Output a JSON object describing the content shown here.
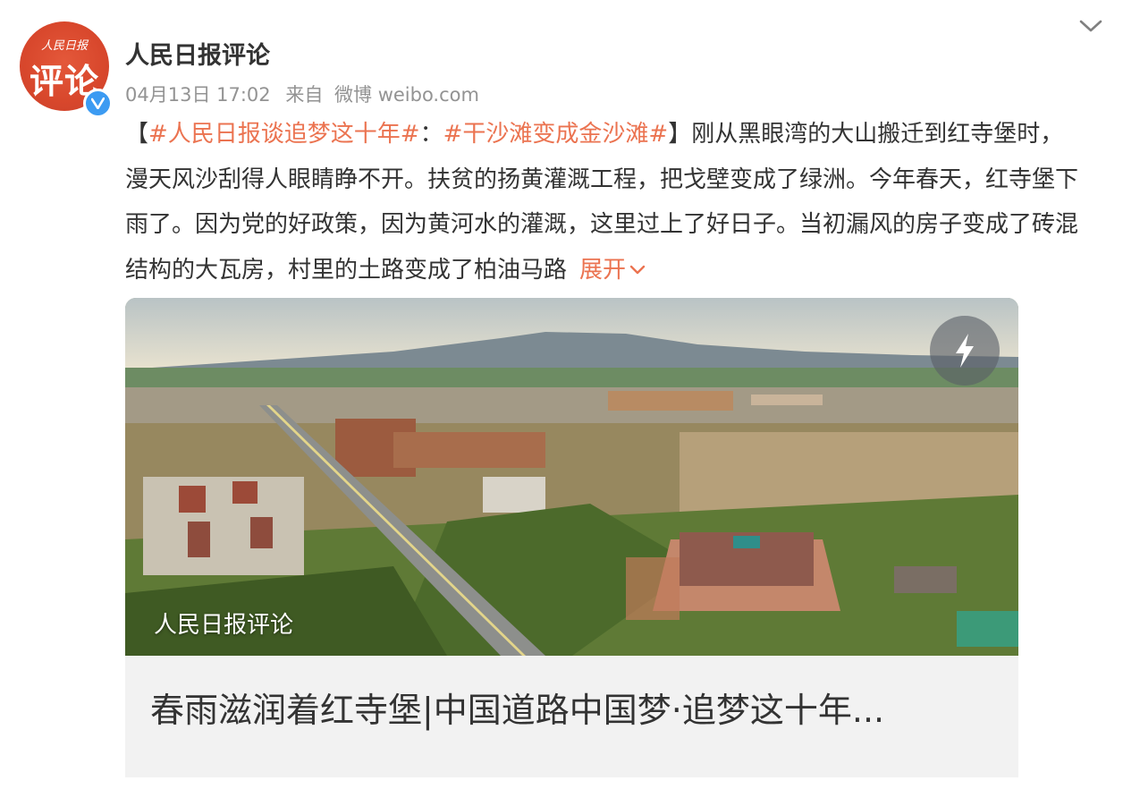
{
  "post": {
    "author": {
      "name": "人民日报评论",
      "avatar_small_text": "人民日报",
      "avatar_big_text": "评论",
      "verified_icon": "verified-badge-icon"
    },
    "time": "04月13日 17:02",
    "source_prefix": "来自",
    "source": "微博 weibo.com",
    "text": {
      "open_bracket": "【",
      "topic1": "#人民日报谈追梦这十年#",
      "colon": "：",
      "topic2": "#干沙滩变成金沙滩#",
      "close_bracket": "】",
      "body": "刚从黑眼湾的大山搬迁到红寺堡时，漫天风沙刮得人眼睛睁不开。扶贫的扬黄灌溉工程，把戈壁变成了绿洲。今年春天，红寺堡下雨了。因为党的好政策，因为黄河水的灌溉，这里过上了好日子。当初漏风的房子变成了砖混结构的大瓦房，村里的土路变成了柏油马路",
      "expand_label": "展开"
    },
    "card": {
      "watermark": "人民日报评论",
      "title": "春雨滋润着红寺堡|中国道路中国梦·追梦这十年..."
    }
  },
  "colors": {
    "accent": "#eb7350",
    "text": "#333333",
    "meta": "#939393",
    "card_bg": "#f2f2f2",
    "verified": "#3c9bf2"
  }
}
